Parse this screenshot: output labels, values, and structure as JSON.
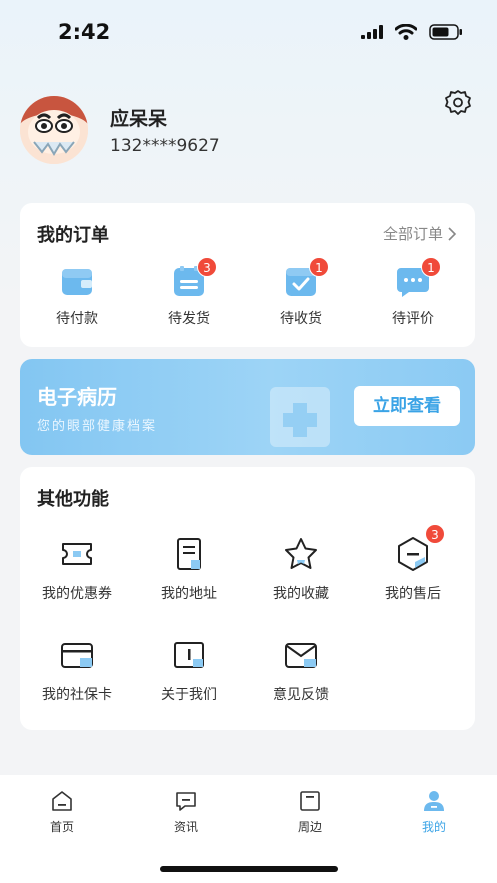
{
  "status_bar": {
    "time": "2:42"
  },
  "profile": {
    "name": "应呆呆",
    "phone": "132****9627"
  },
  "orders": {
    "title": "我的订单",
    "all_label": "全部订单",
    "items": [
      {
        "label": "待付款",
        "icon": "wallet-icon"
      },
      {
        "label": "待发货",
        "icon": "package-icon",
        "badge": "3"
      },
      {
        "label": "待收货",
        "icon": "check-box-icon",
        "badge": "1"
      },
      {
        "label": "待评价",
        "icon": "chat-bubble-icon",
        "badge": "1"
      }
    ]
  },
  "emr": {
    "title": "电子病历",
    "subtitle": "您的眼部健康档案",
    "button": "立即查看"
  },
  "other": {
    "title": "其他功能",
    "items": [
      {
        "label": "我的优惠券",
        "icon": "ticket-icon"
      },
      {
        "label": "我的地址",
        "icon": "document-icon"
      },
      {
        "label": "我的收藏",
        "icon": "star-icon"
      },
      {
        "label": "我的售后",
        "icon": "hexagon-icon",
        "badge": "3"
      },
      {
        "label": "我的社保卡",
        "icon": "card-icon"
      },
      {
        "label": "关于我们",
        "icon": "book-icon"
      },
      {
        "label": "意见反馈",
        "icon": "mail-icon"
      }
    ]
  },
  "tabs": [
    {
      "label": "首页",
      "icon": "home-icon"
    },
    {
      "label": "资讯",
      "icon": "message-icon"
    },
    {
      "label": "周边",
      "icon": "square-icon"
    },
    {
      "label": "我的",
      "icon": "person-icon",
      "active": true
    }
  ],
  "colors": {
    "accent": "#3aa3e6",
    "badge": "#f04a3a",
    "banner": "#8ecbf3"
  }
}
